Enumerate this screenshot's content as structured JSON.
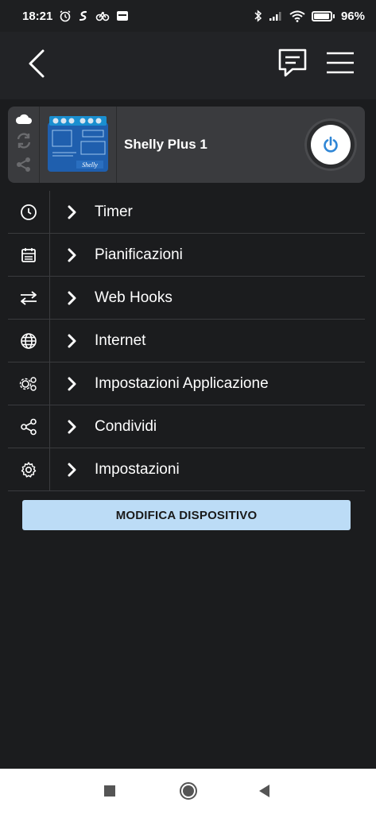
{
  "status_bar": {
    "time": "18:21",
    "battery_percent": "96%",
    "battery_level": 0.96,
    "icons_left": [
      "alarm-icon",
      "app-notification-icon",
      "app-notification-icon",
      "notification-app-icon"
    ],
    "icons_right": [
      "bluetooth-icon",
      "signal-icon",
      "wifi-icon",
      "battery-icon"
    ]
  },
  "header": {
    "back_icon": "back-chevron-icon",
    "message_icon": "message-icon",
    "menu_icon": "hamburger-menu-icon"
  },
  "device": {
    "name": "Shelly Plus 1",
    "side_icons": [
      "cloud-icon",
      "sync-icon",
      "share-icon"
    ],
    "image_label": "Shelly",
    "power_icon": "power-icon",
    "accent_color": "#2f86d6"
  },
  "menu": {
    "items": [
      {
        "label": "Timer",
        "icon": "clock-icon"
      },
      {
        "label": "Pianificazioni",
        "icon": "calendar-icon"
      },
      {
        "label": "Web Hooks",
        "icon": "arrows-swap-icon"
      },
      {
        "label": "Internet",
        "icon": "globe-icon"
      },
      {
        "label": "Impostazioni Applicazione",
        "icon": "app-settings-icon"
      },
      {
        "label": "Condividi",
        "icon": "share-icon"
      },
      {
        "label": "Impostazioni",
        "icon": "gear-icon"
      }
    ]
  },
  "edit_button": {
    "label": "MODIFICA DISPOSITIVO",
    "color": "#bcdcf6"
  },
  "nav_bar": {
    "icons": [
      "recent-apps-icon",
      "home-icon",
      "back-icon"
    ]
  }
}
